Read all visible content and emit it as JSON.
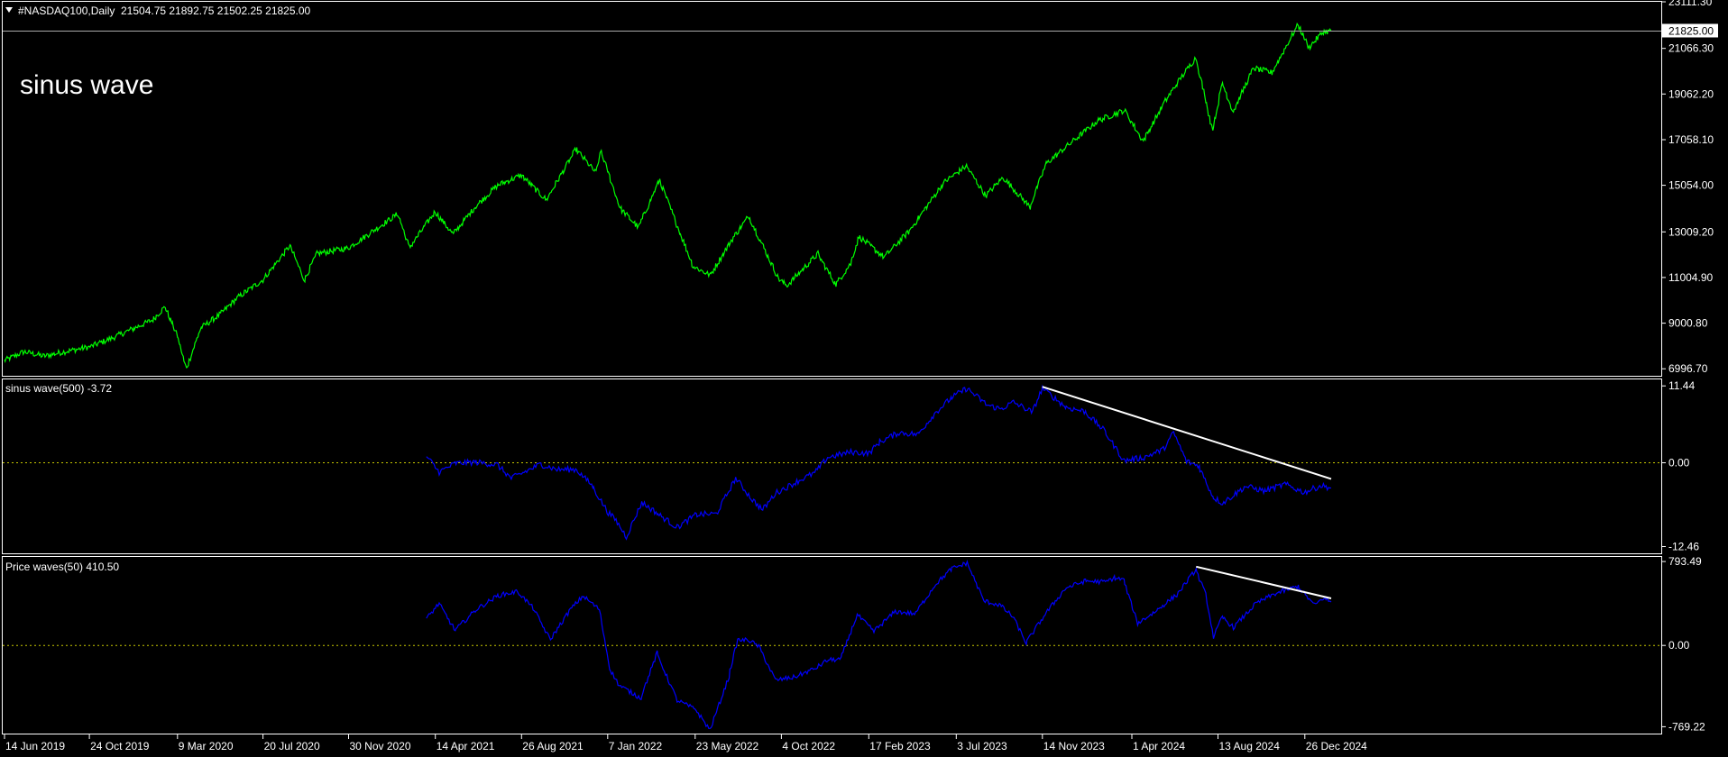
{
  "window": {
    "symbol_header": "#NASDAQ100,Daily",
    "ohlc": "21504.75 21892.75 21502.25 21825.00",
    "annotation": "sinus wave"
  },
  "colors": {
    "background": "#000000",
    "frame": "#ffffff",
    "price_line": "#00ff00",
    "indicator_line": "#0000ff",
    "trendline": "#ffffff",
    "zero_level": "#c8c800"
  },
  "chart_data": [
    {
      "type": "line",
      "panel": "price",
      "title": "#NASDAQ100,Daily  21504.75 21892.75 21502.25 21825.00",
      "y_tick_labels": [
        "23111.30",
        "21066.30",
        "19062.20",
        "17058.10",
        "15054.00",
        "13009.20",
        "11004.90",
        "9000.80",
        "6996.70"
      ],
      "y_ticks": [
        23111.3,
        21066.3,
        19062.2,
        17058.1,
        15054.0,
        13009.2,
        11004.9,
        9000.8,
        6996.7
      ],
      "ylim": [
        6650,
        23111.3
      ],
      "current_price_label": "21825.00",
      "current_price": 21825.0,
      "series": [
        {
          "color": "#00ff00",
          "points": [
            [
              "2019-06-14",
              7350
            ],
            [
              "2019-07-15",
              7750
            ],
            [
              "2019-08-15",
              7550
            ],
            [
              "2019-09-16",
              7750
            ],
            [
              "2019-10-24",
              7950
            ],
            [
              "2019-11-29",
              8350
            ],
            [
              "2019-12-31",
              8750
            ],
            [
              "2020-01-31",
              9150
            ],
            [
              "2020-02-19",
              9720
            ],
            [
              "2020-03-09",
              8450
            ],
            [
              "2020-03-23",
              7000
            ],
            [
              "2020-04-15",
              8800
            ],
            [
              "2020-05-15",
              9400
            ],
            [
              "2020-06-10",
              10100
            ],
            [
              "2020-07-20",
              10900
            ],
            [
              "2020-08-31",
              12400
            ],
            [
              "2020-09-23",
              10900
            ],
            [
              "2020-10-12",
              12050
            ],
            [
              "2020-11-30",
              12300
            ],
            [
              "2020-12-31",
              12900
            ],
            [
              "2021-02-15",
              13800
            ],
            [
              "2021-03-05",
              12300
            ],
            [
              "2021-04-14",
              13900
            ],
            [
              "2021-05-12",
              12900
            ],
            [
              "2021-06-15",
              14100
            ],
            [
              "2021-07-20",
              15050
            ],
            [
              "2021-08-26",
              15500
            ],
            [
              "2021-10-04",
              14400
            ],
            [
              "2021-11-19",
              16650
            ],
            [
              "2021-12-20",
              15600
            ],
            [
              "2021-12-28",
              16550
            ],
            [
              "2022-01-07",
              15700
            ],
            [
              "2022-01-27",
              14050
            ],
            [
              "2022-02-24",
              13200
            ],
            [
              "2022-03-29",
              15300
            ],
            [
              "2022-05-20",
              11500
            ],
            [
              "2022-06-16",
              11100
            ],
            [
              "2022-07-20",
              12700
            ],
            [
              "2022-08-15",
              13700
            ],
            [
              "2022-09-30",
              10950
            ],
            [
              "2022-10-13",
              10650
            ],
            [
              "2022-11-30",
              12050
            ],
            [
              "2022-12-28",
              10700
            ],
            [
              "2023-01-20",
              11600
            ],
            [
              "2023-02-02",
              12800
            ],
            [
              "2023-03-13",
              11900
            ],
            [
              "2023-04-20",
              13000
            ],
            [
              "2023-06-15",
              15200
            ],
            [
              "2023-07-19",
              15900
            ],
            [
              "2023-08-18",
              14600
            ],
            [
              "2023-09-14",
              15400
            ],
            [
              "2023-10-26",
              14100
            ],
            [
              "2023-11-20",
              16000
            ],
            [
              "2023-12-28",
              16900
            ],
            [
              "2024-02-09",
              17900
            ],
            [
              "2024-03-21",
              18350
            ],
            [
              "2024-04-19",
              17000
            ],
            [
              "2024-05-22",
              18700
            ],
            [
              "2024-06-20",
              19900
            ],
            [
              "2024-07-10",
              20650
            ],
            [
              "2024-08-05",
              17500
            ],
            [
              "2024-08-20",
              19550
            ],
            [
              "2024-09-06",
              18300
            ],
            [
              "2024-10-08",
              20200
            ],
            [
              "2024-11-05",
              20000
            ],
            [
              "2024-12-16",
              22100
            ],
            [
              "2025-01-02",
              21100
            ],
            [
              "2025-01-24",
              21800
            ],
            [
              "2025-02-05",
              21825
            ]
          ]
        }
      ]
    },
    {
      "type": "line",
      "panel": "indicator-1",
      "title": "sinus wave(500) -3.72",
      "y_tick_labels": [
        "11.44",
        "0.00",
        "-12.46"
      ],
      "y_ticks": [
        11.44,
        0.0,
        -12.46
      ],
      "ylim": [
        -13.6,
        12.4
      ],
      "zero_line": 0.0,
      "series": [
        {
          "color": "#0000ff",
          "points": [
            [
              "2021-03-31",
              1.0
            ],
            [
              "2021-04-20",
              -1.4
            ],
            [
              "2021-05-15",
              -0.1
            ],
            [
              "2021-06-15",
              0.1
            ],
            [
              "2021-07-20",
              -0.3
            ],
            [
              "2021-08-10",
              -2.3
            ],
            [
              "2021-08-26",
              -1.6
            ],
            [
              "2021-09-25",
              -0.2
            ],
            [
              "2021-10-20",
              -1.0
            ],
            [
              "2021-11-20",
              -1.0
            ],
            [
              "2021-12-15",
              -3.5
            ],
            [
              "2022-01-05",
              -7.0
            ],
            [
              "2022-01-20",
              -8.6
            ],
            [
              "2022-02-05",
              -11.0
            ],
            [
              "2022-03-01",
              -5.9
            ],
            [
              "2022-03-25",
              -7.5
            ],
            [
              "2022-04-25",
              -9.6
            ],
            [
              "2022-05-25",
              -7.7
            ],
            [
              "2022-06-25",
              -7.6
            ],
            [
              "2022-07-25",
              -2.3
            ],
            [
              "2022-08-20",
              -5.5
            ],
            [
              "2022-09-05",
              -7.0
            ],
            [
              "2022-09-25",
              -4.5
            ],
            [
              "2022-10-25",
              -3.0
            ],
            [
              "2022-11-25",
              -1.5
            ],
            [
              "2022-12-15",
              0.8
            ],
            [
              "2023-01-20",
              1.6
            ],
            [
              "2023-02-17",
              1.4
            ],
            [
              "2023-03-05",
              3.0
            ],
            [
              "2023-04-05",
              4.5
            ],
            [
              "2023-05-05",
              4.2
            ],
            [
              "2023-06-01",
              7.5
            ],
            [
              "2023-06-25",
              9.6
            ],
            [
              "2023-07-20",
              11.1
            ],
            [
              "2023-08-20",
              8.6
            ],
            [
              "2023-09-10",
              8.0
            ],
            [
              "2023-09-30",
              9.0
            ],
            [
              "2023-10-30",
              7.5
            ],
            [
              "2023-11-14",
              11.1
            ],
            [
              "2023-12-20",
              8.3
            ],
            [
              "2024-01-20",
              7.6
            ],
            [
              "2024-02-20",
              4.6
            ],
            [
              "2024-03-20",
              0.3
            ],
            [
              "2024-04-20",
              0.8
            ],
            [
              "2024-05-20",
              2.0
            ],
            [
              "2024-06-05",
              4.5
            ],
            [
              "2024-06-25",
              0.2
            ],
            [
              "2024-07-15",
              -0.5
            ],
            [
              "2024-08-05",
              -5.0
            ],
            [
              "2024-08-20",
              -6.0
            ],
            [
              "2024-09-25",
              -3.5
            ],
            [
              "2024-10-25",
              -4.2
            ],
            [
              "2024-11-25",
              -3.2
            ],
            [
              "2024-12-25",
              -4.4
            ],
            [
              "2025-01-20",
              -3.4
            ],
            [
              "2025-02-05",
              -3.72
            ]
          ]
        }
      ],
      "trendline": {
        "color": "#ffffff",
        "points": [
          [
            "2023-11-14",
            11.3
          ],
          [
            "2025-02-05",
            -2.4
          ]
        ]
      }
    },
    {
      "type": "line",
      "panel": "indicator-2",
      "title": "Price waves(50) 410.50",
      "y_tick_labels": [
        "793.49",
        "0.00",
        "-769.22"
      ],
      "y_ticks": [
        793.49,
        0.0,
        -769.22
      ],
      "ylim": [
        -842.8,
        837.0
      ],
      "zero_line": 0.0,
      "series": [
        {
          "color": "#0000ff",
          "points": [
            [
              "2021-03-31",
              250
            ],
            [
              "2021-04-20",
              400
            ],
            [
              "2021-05-15",
              140
            ],
            [
              "2021-06-15",
              330
            ],
            [
              "2021-07-20",
              470
            ],
            [
              "2021-08-20",
              510
            ],
            [
              "2021-09-15",
              340
            ],
            [
              "2021-10-10",
              50
            ],
            [
              "2021-11-10",
              340
            ],
            [
              "2021-11-30",
              470
            ],
            [
              "2021-12-25",
              340
            ],
            [
              "2022-01-10",
              -210
            ],
            [
              "2022-01-25",
              -380
            ],
            [
              "2022-02-28",
              -500
            ],
            [
              "2022-03-25",
              -70
            ],
            [
              "2022-04-25",
              -520
            ],
            [
              "2022-05-25",
              -610
            ],
            [
              "2022-06-15",
              -800
            ],
            [
              "2022-07-15",
              -290
            ],
            [
              "2022-07-28",
              50
            ],
            [
              "2022-08-15",
              50
            ],
            [
              "2022-08-30",
              -10
            ],
            [
              "2022-09-25",
              -330
            ],
            [
              "2022-10-25",
              -300
            ],
            [
              "2022-11-25",
              -220
            ],
            [
              "2022-12-15",
              -140
            ],
            [
              "2023-01-05",
              -130
            ],
            [
              "2023-01-30",
              290
            ],
            [
              "2023-02-25",
              130
            ],
            [
              "2023-03-30",
              320
            ],
            [
              "2023-05-01",
              300
            ],
            [
              "2023-06-01",
              580
            ],
            [
              "2023-06-25",
              720
            ],
            [
              "2023-07-20",
              780
            ],
            [
              "2023-08-15",
              420
            ],
            [
              "2023-09-10",
              380
            ],
            [
              "2023-10-01",
              260
            ],
            [
              "2023-10-20",
              20
            ],
            [
              "2023-11-20",
              310
            ],
            [
              "2023-12-20",
              540
            ],
            [
              "2024-01-20",
              610
            ],
            [
              "2024-02-20",
              600
            ],
            [
              "2024-03-05",
              640
            ],
            [
              "2024-03-20",
              620
            ],
            [
              "2024-04-10",
              210
            ],
            [
              "2024-05-10",
              330
            ],
            [
              "2024-06-10",
              480
            ],
            [
              "2024-07-10",
              720
            ],
            [
              "2024-07-25",
              480
            ],
            [
              "2024-08-06",
              80
            ],
            [
              "2024-08-20",
              270
            ],
            [
              "2024-09-06",
              170
            ],
            [
              "2024-10-10",
              390
            ],
            [
              "2024-11-10",
              490
            ],
            [
              "2024-12-16",
              560
            ],
            [
              "2025-01-10",
              380
            ],
            [
              "2025-01-24",
              450
            ],
            [
              "2025-02-05",
              410.5
            ]
          ]
        }
      ],
      "trendline": {
        "color": "#ffffff",
        "points": [
          [
            "2024-07-10",
            745
          ],
          [
            "2025-02-05",
            445
          ]
        ]
      }
    }
  ],
  "x_axis": {
    "type": "date",
    "range": [
      "2019-06-14",
      "2025-02-05"
    ],
    "ticks": [
      {
        "date": "2019-06-14",
        "label": "14 Jun 2019"
      },
      {
        "date": "2019-10-24",
        "label": "24 Oct 2019"
      },
      {
        "date": "2020-03-09",
        "label": "9 Mar 2020"
      },
      {
        "date": "2020-07-20",
        "label": "20 Jul 2020"
      },
      {
        "date": "2020-11-30",
        "label": "30 Nov 2020"
      },
      {
        "date": "2021-04-14",
        "label": "14 Apr 2021"
      },
      {
        "date": "2021-08-26",
        "label": "26 Aug 2021"
      },
      {
        "date": "2022-01-07",
        "label": "7 Jan 2022"
      },
      {
        "date": "2022-05-23",
        "label": "23 May 2022"
      },
      {
        "date": "2022-10-04",
        "label": "4 Oct 2022"
      },
      {
        "date": "2023-02-17",
        "label": "17 Feb 2023"
      },
      {
        "date": "2023-07-03",
        "label": "3 Jul 2023"
      },
      {
        "date": "2023-11-14",
        "label": "14 Nov 2023"
      },
      {
        "date": "2024-04-01",
        "label": "1 Apr 2024"
      },
      {
        "date": "2024-08-13",
        "label": "13 Aug 2024"
      },
      {
        "date": "2024-12-26",
        "label": "26 Dec 2024"
      }
    ]
  }
}
